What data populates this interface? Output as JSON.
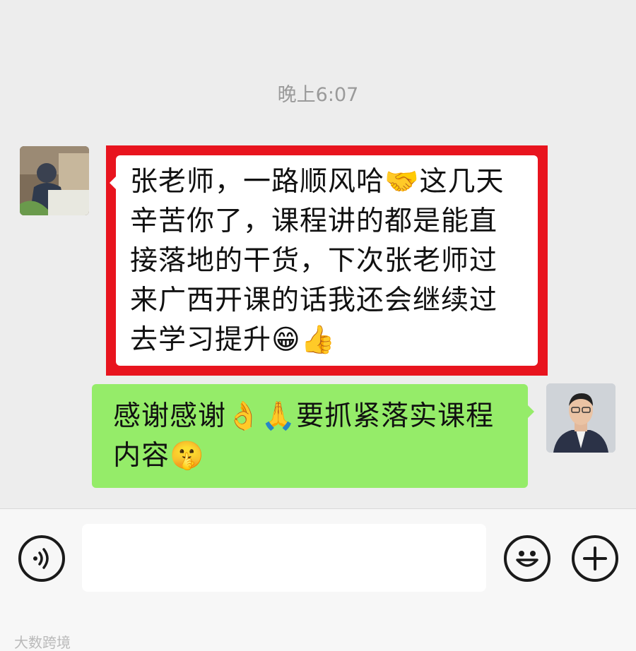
{
  "chat": {
    "timestamp": "晚上6:07",
    "messages": [
      {
        "side": "received",
        "lines": [
          "张老师，一路顺风哈🤝这几天",
          "辛苦你了，课程讲的都是能直",
          "接落地的干货，下次张老师过",
          "来广西开课的话我还会继续过",
          "去学习提升😁👍"
        ]
      },
      {
        "side": "sent",
        "lines": [
          "感谢感谢👌🙏要抓紧落实课程",
          "内容🤫"
        ]
      }
    ]
  },
  "input_bar": {
    "placeholder": "",
    "voice_icon": "voice-icon",
    "emoji_icon": "smiley-icon",
    "plus_icon": "plus-icon"
  },
  "watermark": "大数跨境",
  "colors": {
    "background": "#ededed",
    "sent_bubble": "#95ec69",
    "received_bubble": "#ffffff",
    "highlight": "#e8141e"
  }
}
